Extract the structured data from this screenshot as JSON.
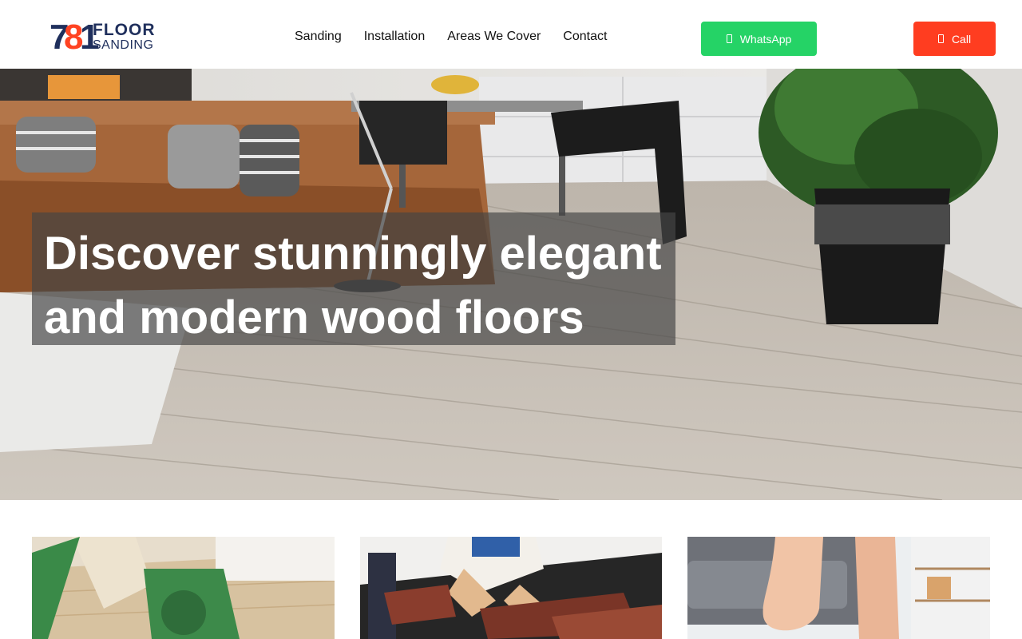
{
  "header": {
    "logo": {
      "number_a": "7",
      "number_b": "8",
      "number_c": "1",
      "line1": "FLOOR",
      "line2": "SANDING"
    },
    "nav": [
      "Sanding",
      "Installation",
      "Areas We Cover",
      "Contact"
    ],
    "whatsapp_label": "WhatsApp",
    "call_label": "Call",
    "icons": {
      "whatsapp": "phone-icon",
      "call": "phone-icon"
    }
  },
  "hero": {
    "title": "Discover stunningly elegant and modern wood floors",
    "image": "living-room-wood-floor-photo"
  },
  "cards": [
    {
      "image": "floor-sanding-machine-photo"
    },
    {
      "image": "wood-floor-installation-photo"
    },
    {
      "image": "barefoot-on-wood-floor-photo"
    }
  ],
  "colors": {
    "brand_navy": "#1f2f5c",
    "brand_orange": "#ff4322",
    "whatsapp_green": "#25d366",
    "call_red": "#ff3d20"
  }
}
